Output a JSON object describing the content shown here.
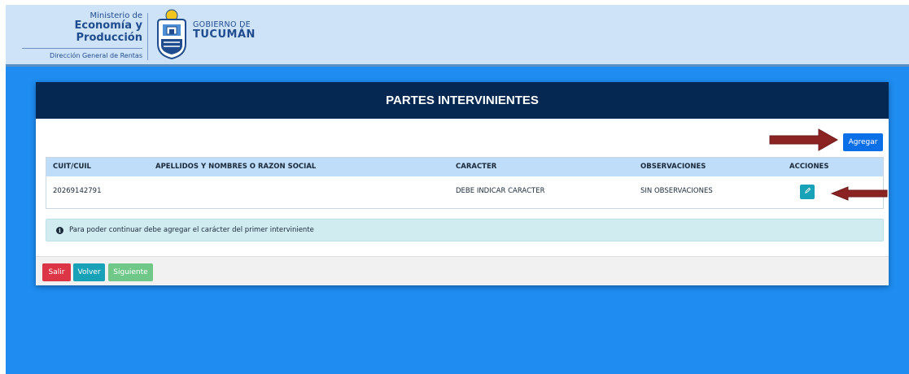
{
  "header": {
    "ministry_small": "Ministerio de",
    "ministry_big": "Economía y Producción",
    "ministry_sub": "Dirección General de Rentas",
    "gov_small": "GOBIERNO DE",
    "gov_big": "TUCUMÁN"
  },
  "card": {
    "title": "PARTES INTERVINIENTES",
    "add_label": "Agregar"
  },
  "table": {
    "headers": [
      "CUIT/CUIL",
      "APELLIDOS Y NOMBRES O RAZON SOCIAL",
      "CARACTER",
      "OBSERVACIONES",
      "ACCIONES"
    ],
    "rows": [
      {
        "cuit": "20269142791",
        "nombre": "",
        "caracter": "DEBE INDICAR CARACTER",
        "observaciones": "SIN OBSERVACIONES",
        "action_icon": "pencil-icon"
      }
    ]
  },
  "alert": {
    "icon": "info-icon",
    "text": "Para poder continuar debe agregar el carácter del primer interviniente"
  },
  "footer": {
    "exit_label": "Salir",
    "back_label": "Volver",
    "next_label": "Siguiente"
  },
  "colors": {
    "background": "#1e8cf0",
    "card_header": "#042852",
    "table_header": "#bfdcf8",
    "primary_button": "#0b6fe8",
    "danger_button": "#dc3545",
    "info_button": "#17a2b8",
    "success_button_disabled": "#6fc888",
    "alert_background": "#d1ecf1",
    "annotation_arrow": "#8b2323"
  }
}
